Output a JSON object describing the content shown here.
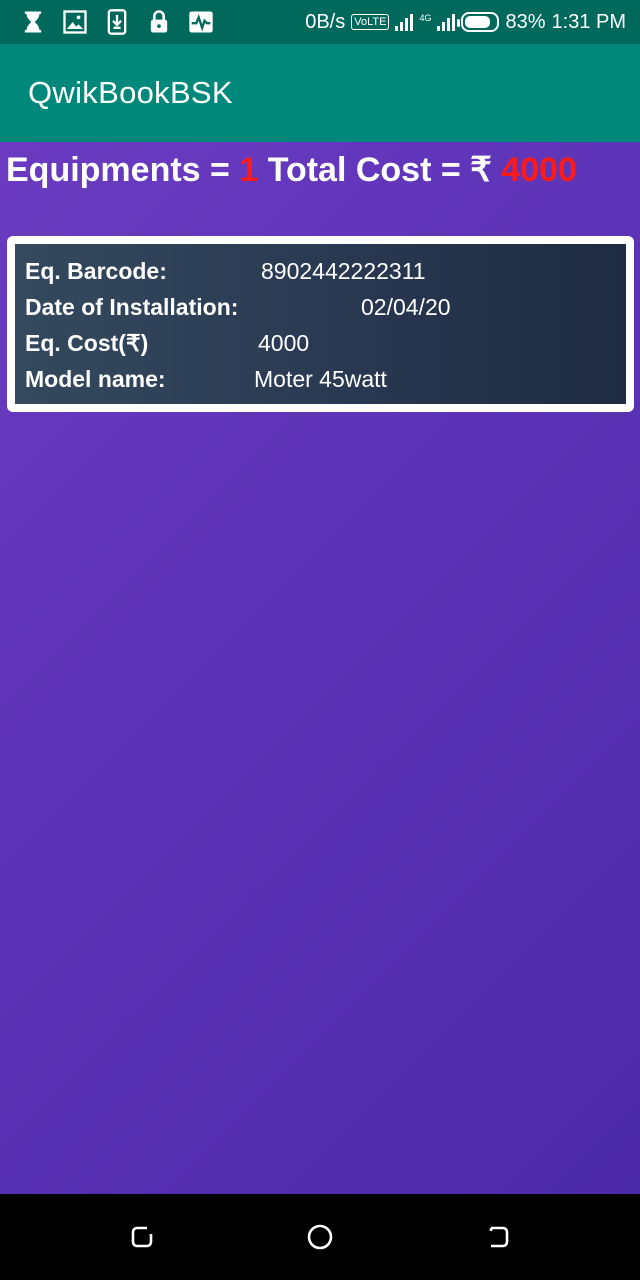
{
  "status_bar": {
    "left_icons": [
      "hourglass-icon",
      "image-icon",
      "download-icon",
      "lock-icon",
      "activity-icon"
    ],
    "data_speed": "0B/s",
    "volte": "VoLTE",
    "network": "4G",
    "battery_percent": "83%",
    "battery_level": 0.83,
    "time": "1:31 PM"
  },
  "app_bar": {
    "title": "QwikBookBSK"
  },
  "summary": {
    "equipments_label": "Equipments = ",
    "equipments_count": "1",
    "total_cost_label": " Total Cost = ₹ ",
    "total_cost": "4000"
  },
  "equipment_card": {
    "barcode_label": "Eq. Barcode:",
    "barcode_value": "8902442222311",
    "install_date_label": "Date of Installation:",
    "install_date_value": "02/04/20",
    "cost_label": "Eq. Cost(₹)",
    "cost_value": "4000",
    "model_label": "Model name:",
    "model_value": "Moter 45watt"
  },
  "colors": {
    "status_bar": "#00695c",
    "app_bar": "#00897b",
    "content_bg": "#5a32b5",
    "highlight_red": "#ff1a1a",
    "card_bg": "#2a3a52"
  },
  "nav_bar": {
    "icons": [
      "recent-apps-icon",
      "home-icon",
      "back-icon"
    ]
  }
}
